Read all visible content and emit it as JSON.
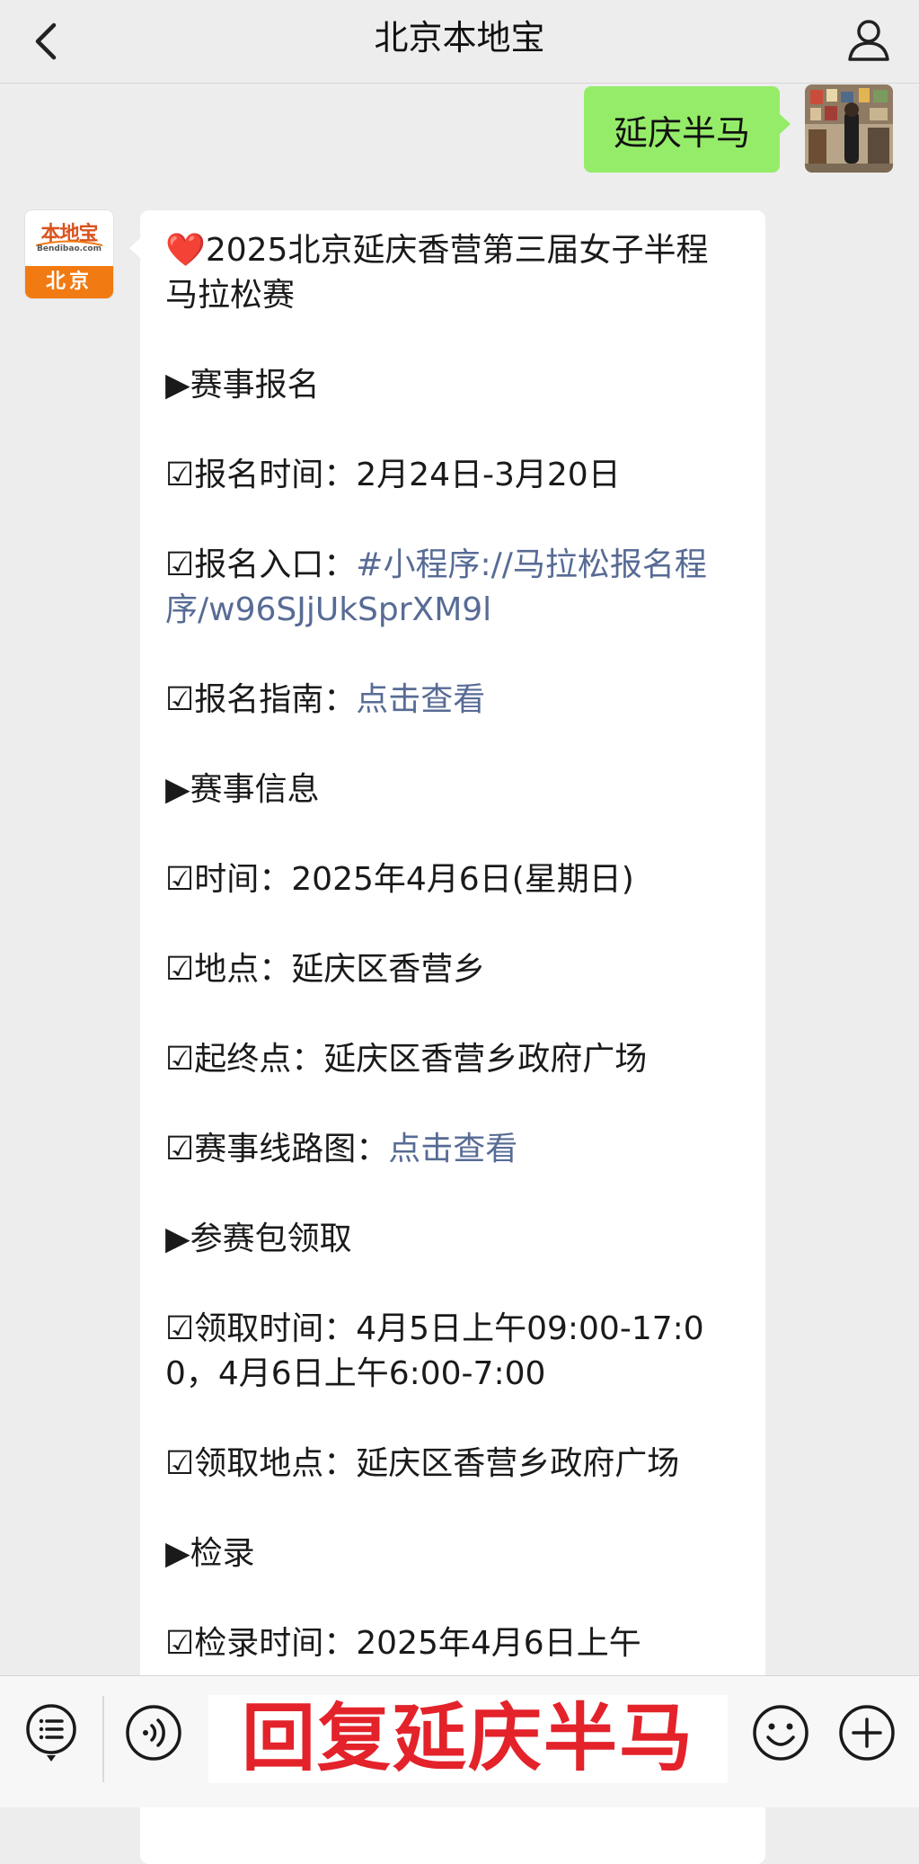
{
  "header": {
    "title": "北京本地宝"
  },
  "conversation": {
    "outgoing_message": "延庆半马",
    "brand_avatar": {
      "name": "本地宝",
      "domain": "Bendibao.com",
      "city": "北京"
    },
    "incoming_message": {
      "title_emoji": "❤️",
      "title": "2025北京延庆香营第三届女子半程马拉松赛",
      "sec1": "▶赛事报名",
      "reg_time": "☑报名时间：2月24日-3月20日",
      "reg_entry_label": "☑报名入口：",
      "reg_entry_link": "#小程序://马拉松报名程序/w96SJjUkSprXM9l",
      "reg_guide_label": "☑报名指南：",
      "reg_guide_link": "点击查看",
      "sec2": "▶赛事信息",
      "event_time": "☑时间：2025年4月6日(星期日)",
      "event_place": "☑地点：延庆区香营乡",
      "start_end": "☑起终点：延庆区香营乡政府广场",
      "route_label": "☑赛事线路图：",
      "route_link": "点击查看",
      "sec3": "▶参赛包领取",
      "pickup_time": "☑领取时间：4月5日上午09:00-17:00，4月6日上午6:00-7:00",
      "pickup_place": "☑领取地点：延庆区香营乡政府广场",
      "sec4": "▶检录",
      "checkin_time": "☑检录时间：2025年4月6日上午"
    }
  },
  "bottom_bar": {
    "reply_banner": "回复延庆半马"
  },
  "colors": {
    "outgoing_bubble": "#95ec69",
    "link": "#576b95",
    "banner_text": "#e3222a",
    "brand_orange": "#f27a12"
  },
  "icons": {
    "back": "chevron-left-icon",
    "profile": "person-icon",
    "menu": "list-menu-icon",
    "voice": "voice-icon",
    "emoji": "smiley-icon",
    "plus": "plus-circle-icon"
  }
}
